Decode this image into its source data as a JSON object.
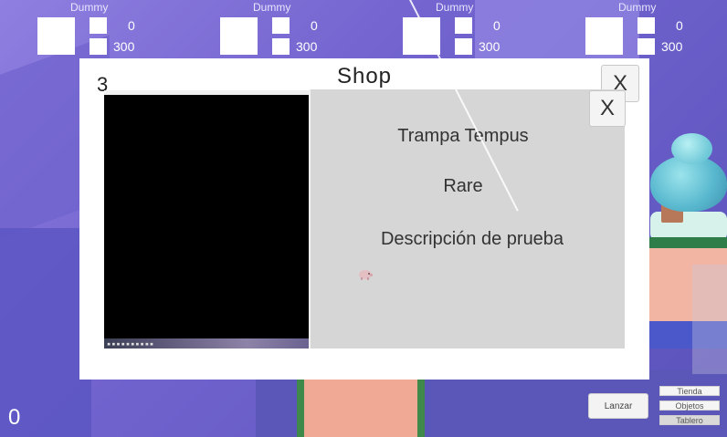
{
  "players": [
    {
      "name": "Dummy",
      "stat_top": "0",
      "stat_bottom": "300"
    },
    {
      "name": "Dummy",
      "stat_top": "0",
      "stat_bottom": "300"
    },
    {
      "name": "Dummy",
      "stat_top": "0",
      "stat_bottom": "300"
    },
    {
      "name": "Dummy",
      "stat_top": "0",
      "stat_bottom": "300"
    }
  ],
  "shop": {
    "title": "Shop",
    "counter": "3",
    "close_label": "X",
    "detail_close_label": "X",
    "item": {
      "name": "Trampa Tempus",
      "rarity": "Rare",
      "description": "Descripción de prueba"
    }
  },
  "hud": {
    "score": "0",
    "lanzar_label": "Lanzar",
    "menu": [
      "Tienda",
      "Objetos",
      "Tablero"
    ]
  },
  "colors": {
    "background": "#7d6fd3",
    "panel": "#ffffff",
    "detail_panel": "#d6d6d6"
  }
}
